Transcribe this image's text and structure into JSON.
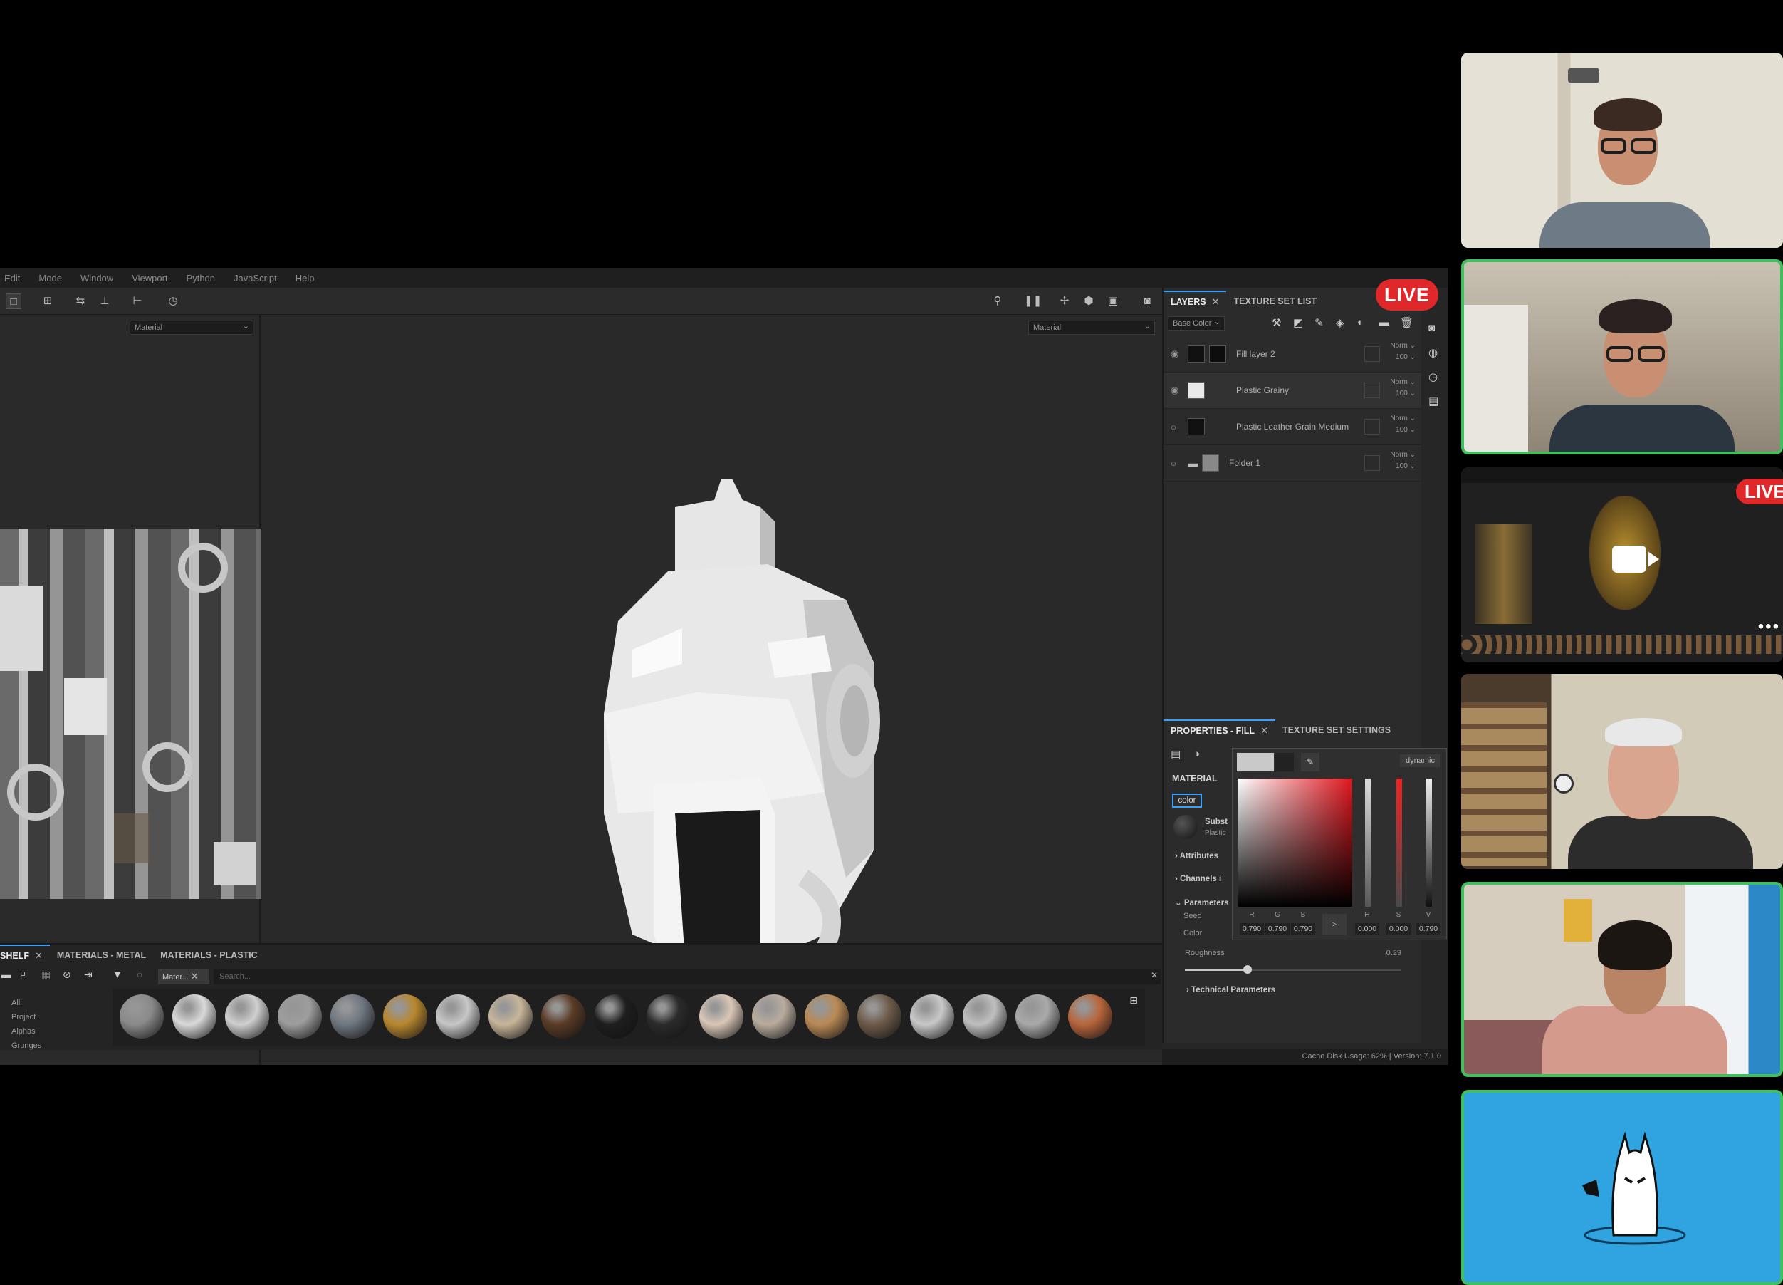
{
  "menu": [
    "Edit",
    "Mode",
    "Window",
    "Viewport",
    "Python",
    "JavaScript",
    "Help"
  ],
  "viewports": {
    "uv_dropdown": "Material",
    "main_dropdown": "Material"
  },
  "live_badge": "LIVE",
  "layers_panel": {
    "tabs": [
      "LAYERS",
      "TEXTURE SET LIST"
    ],
    "channel_dropdown": "Base Color",
    "layers": [
      {
        "name": "Fill layer 2",
        "blend": "Norm",
        "opacity": "100",
        "visible": true
      },
      {
        "name": "Plastic Grainy",
        "blend": "Norm",
        "opacity": "100",
        "visible": true
      },
      {
        "name": "Plastic Leather Grain Medium",
        "blend": "Norm",
        "opacity": "100",
        "visible": false
      },
      {
        "name": "Folder 1",
        "blend": "Norm",
        "opacity": "100",
        "visible": false
      }
    ]
  },
  "properties_panel": {
    "tabs": [
      "PROPERTIES - FILL",
      "TEXTURE SET SETTINGS"
    ],
    "material_label": "MATERIAL",
    "color_chip": "color",
    "substance_label": "Subst",
    "substance_sub": "Plastic",
    "attributes_label": "Attributes",
    "channels_label": "Channels i",
    "parameters_label": "Parameters",
    "seed_label": "Seed",
    "color_label": "Color",
    "roughness_label": "Roughness",
    "roughness_value": "0.29",
    "roughness_fraction": 0.29,
    "technical_label": "Technical Parameters"
  },
  "color_picker": {
    "mode_button": "dynamic",
    "labels": [
      "R",
      "G",
      "B",
      "H",
      "S",
      "V"
    ],
    "values": [
      "0.790",
      "0.790",
      "0.790",
      "0.000",
      "0.000",
      "0.790"
    ],
    "arrow": ">"
  },
  "shelf": {
    "tabs": [
      "SHELF",
      "MATERIALS - METAL",
      "MATERIALS - PLASTIC"
    ],
    "filter_chip": "Mater...",
    "search_placeholder": "Search...",
    "categories": [
      "All",
      "Project",
      "Alphas",
      "Grunges"
    ],
    "spheres": [
      "#8a8a8a",
      "#d9d9d9",
      "#cfcfcf",
      "#9d9d9d",
      "#6f7780",
      "#b8872f",
      "#c7c7c7",
      "#c8b59a",
      "#5a3b26",
      "#1e1e1e",
      "#2b2b2b",
      "#d9c7b7",
      "#b9ac9e",
      "#b98a55",
      "#6e5b4a",
      "#c8c8c8",
      "#bfbfbf",
      "#a9a9a9",
      "#b8653b"
    ]
  },
  "status": "Cache Disk Usage: 62% | Version: 7.1.0",
  "participants": {
    "screen_share_live": "LIVE",
    "more_dots": "•••"
  }
}
